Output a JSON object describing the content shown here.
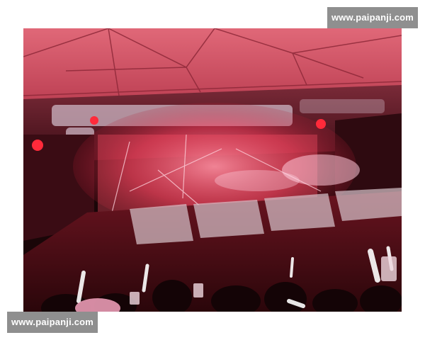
{
  "watermark": {
    "top_text": "www.paipanji.com",
    "bottom_text": "www.paipanji.com"
  },
  "colors": {
    "roof": "#d9566a",
    "stage_glow": "#ff3a4e",
    "crowd": "#c9b8c2",
    "floor": "#5a0f18"
  }
}
